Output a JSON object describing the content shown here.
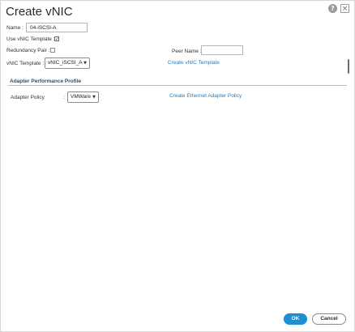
{
  "dialog": {
    "title": "Create vNIC",
    "help_glyph": "?",
    "close_glyph": "×"
  },
  "form": {
    "name_label": "Name :",
    "name_value": "04-iSCSI-A",
    "use_template_label": "Use vNIC Template :",
    "use_template_checked": true,
    "redundancy_label": "Redundancy Pair :",
    "redundancy_checked": false,
    "peer_name_label": "Peer Name :",
    "peer_name_value": "",
    "template_label": "vNIC Template :",
    "template_value": "vNIC_iSCSI_A",
    "create_template_link": "Create vNIC Template"
  },
  "adapter_section": {
    "header": "Adapter Performance Profile",
    "policy_label": "Adapter Policy",
    "policy_colon": ":",
    "policy_value": "VMWare",
    "create_policy_link": "Create Ethernet Adapter Policy"
  },
  "footer": {
    "ok_label": "OK",
    "cancel_label": "Cancel"
  },
  "icons": {
    "checkmark": "✓",
    "dropdown_arrow": "▼"
  },
  "colors": {
    "accent": "#1e8fd2",
    "link": "#2d7ab3",
    "section_header": "#2e4f6e"
  }
}
